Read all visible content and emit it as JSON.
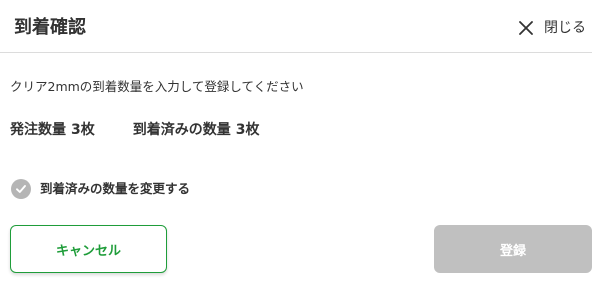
{
  "dialog": {
    "title": "到着確認",
    "close": {
      "label": "閉じる",
      "icon": "close-icon"
    },
    "instruction": "クリア2mmの到着数量を入力して登録してください",
    "order_quantity": {
      "label": "発注数量",
      "value": "3枚"
    },
    "arrived_quantity": {
      "label": "到着済みの数量",
      "value": "3枚"
    },
    "change_quantity_checkbox": {
      "label": "到着済みの数量を変更する",
      "checked": false,
      "icon": "check-circle-icon"
    },
    "cancel_button": {
      "label": "キャンセル"
    },
    "submit_button": {
      "label": "登録",
      "disabled": true
    }
  },
  "colors": {
    "accent": "#1f9d3a",
    "text": "#333333",
    "disabled": "#c0c0c0",
    "checkbox_off": "#b5b5b5",
    "divider": "#dcdcdc"
  }
}
